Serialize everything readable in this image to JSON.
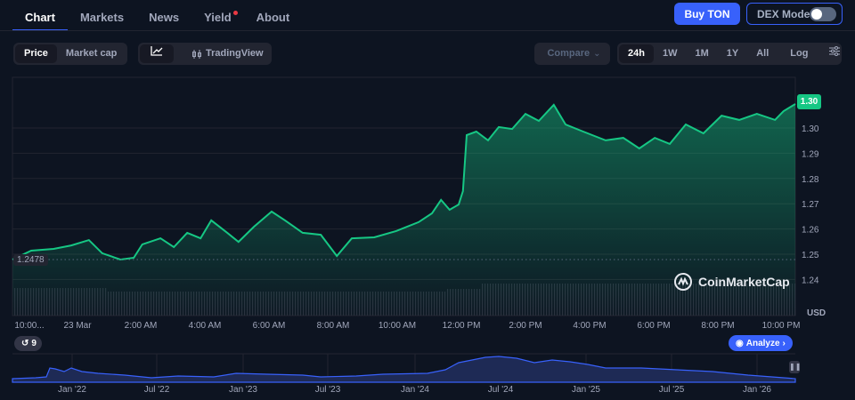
{
  "nav": {
    "tabs": [
      {
        "label": "Chart",
        "active": true
      },
      {
        "label": "Markets"
      },
      {
        "label": "News"
      },
      {
        "label": "Yield",
        "dot": true
      },
      {
        "label": "About"
      }
    ]
  },
  "header": {
    "buy_label": "Buy TON",
    "dex_label": "DEX Mode",
    "dex_on": false
  },
  "controls": {
    "price": "Price",
    "market_cap": "Market cap",
    "line_icon": "line-chart-icon",
    "tradingview": "TradingView",
    "compare": "Compare",
    "ranges": [
      "24h",
      "1W",
      "1M",
      "1Y",
      "All"
    ],
    "active_range": "24h",
    "log": "Log",
    "settings_icon": "sliders-icon"
  },
  "colors": {
    "up": "#16c784",
    "accent": "#3861fb",
    "bg": "#0d1421"
  },
  "chart": {
    "open_label": "1.2478",
    "current_label": "1.30",
    "currency": "USD",
    "watermark": "CoinMarketCap",
    "history_count": "9",
    "analyze": "Analyze",
    "x_labels": [
      "10:00...",
      "23 Mar",
      "2:00 AM",
      "4:00 AM",
      "6:00 AM",
      "8:00 AM",
      "10:00 AM",
      "12:00 PM",
      "2:00 PM",
      "4:00 PM",
      "6:00 PM",
      "8:00 PM",
      "10:00 PM"
    ],
    "overview_labels": [
      "Jan '22",
      "Jul '22",
      "Jan '23",
      "Jul '23",
      "Jan '24",
      "Jul '24",
      "Jan '25",
      "Jul '25",
      "Jan '26"
    ]
  },
  "chart_data": {
    "type": "line",
    "ylim": [
      1.235,
      1.315
    ],
    "yticks": [
      1.24,
      1.25,
      1.26,
      1.27,
      1.28,
      1.29,
      1.3
    ],
    "grid": true,
    "points": [
      [
        "22:00",
        1.2479
      ],
      [
        "22:35",
        1.2514
      ],
      [
        "23:17",
        1.2521
      ],
      [
        "23:50",
        1.2535
      ],
      [
        "00:23",
        1.2556
      ],
      [
        "00:48",
        1.2504
      ],
      [
        "01:22",
        1.2479
      ],
      [
        "01:47",
        1.2486
      ],
      [
        "02:03",
        1.2539
      ],
      [
        "02:37",
        1.2563
      ],
      [
        "03:02",
        1.2528
      ],
      [
        "03:27",
        1.2585
      ],
      [
        "03:52",
        1.2563
      ],
      [
        "04:12",
        1.2634
      ],
      [
        "04:42",
        1.2585
      ],
      [
        "05:03",
        1.2549
      ],
      [
        "05:32",
        1.2609
      ],
      [
        "06:05",
        1.2669
      ],
      [
        "06:30",
        1.2634
      ],
      [
        "07:03",
        1.2585
      ],
      [
        "07:37",
        1.2577
      ],
      [
        "08:07",
        1.2493
      ],
      [
        "08:35",
        1.2563
      ],
      [
        "09:17",
        1.2567
      ],
      [
        "09:58",
        1.2592
      ],
      [
        "10:40",
        1.2627
      ],
      [
        "11:05",
        1.2662
      ],
      [
        "11:22",
        1.2715
      ],
      [
        "11:38",
        1.2676
      ],
      [
        "11:55",
        1.2697
      ],
      [
        "12:03",
        1.275
      ],
      [
        "12:10",
        1.2972
      ],
      [
        "12:28",
        1.2986
      ],
      [
        "12:50",
        1.2951
      ],
      [
        "13:10",
        1.3004
      ],
      [
        "13:35",
        1.2996
      ],
      [
        "14:00",
        1.3056
      ],
      [
        "14:25",
        1.3028
      ],
      [
        "14:53",
        1.3092
      ],
      [
        "15:15",
        1.3014
      ],
      [
        "15:48",
        1.2986
      ],
      [
        "16:30",
        1.2951
      ],
      [
        "17:03",
        1.2961
      ],
      [
        "17:33",
        1.2919
      ],
      [
        "18:02",
        1.2961
      ],
      [
        "18:30",
        1.2937
      ],
      [
        "19:00",
        1.3014
      ],
      [
        "19:33",
        1.2979
      ],
      [
        "20:07",
        1.3049
      ],
      [
        "20:40",
        1.3032
      ],
      [
        "21:13",
        1.3056
      ],
      [
        "21:47",
        1.3032
      ],
      [
        "22:03",
        1.3067
      ],
      [
        "22:25",
        1.3095
      ]
    ]
  }
}
